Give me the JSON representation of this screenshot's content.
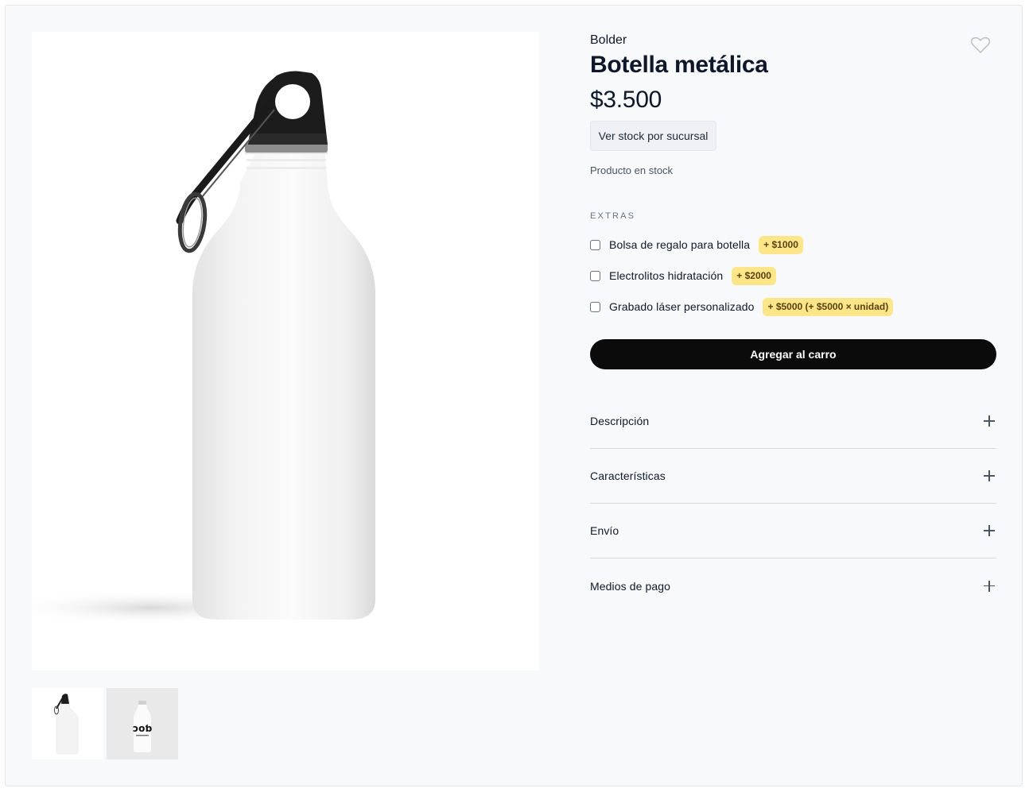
{
  "product": {
    "brand": "Bolder",
    "title": "Botella metálica",
    "price": "$3.500",
    "stock_button": "Ver stock por sucursal",
    "stock_status": "Producto en stock",
    "favorite_icon": "heart-outline-icon"
  },
  "extras": {
    "heading": "EXTRAS",
    "options": [
      {
        "label": "Bolsa de regalo para botella",
        "price": "+ $1000",
        "checked": false
      },
      {
        "label": "Electrolitos hidratación",
        "price": "+ $2000",
        "checked": false
      },
      {
        "label": "Grabado láser personalizado",
        "price": "+ $5000 (+ $5000 × unidad)",
        "checked": false
      }
    ]
  },
  "cart": {
    "label": "Agregar al carro"
  },
  "accordion": [
    {
      "label": "Descripción",
      "icon": "plus-icon"
    },
    {
      "label": "Características",
      "icon": "plus-icon"
    },
    {
      "label": "Envío",
      "icon": "plus-icon"
    },
    {
      "label": "Medios de pago",
      "icon": "plus-icon"
    }
  ],
  "gallery": {
    "thumbnails": [
      "bottle-with-carabiner",
      "bottle-with-logo"
    ]
  },
  "colors": {
    "badge": "#fde68a",
    "cart_button": "#0b0b0c",
    "background": "#f8f9fb"
  }
}
